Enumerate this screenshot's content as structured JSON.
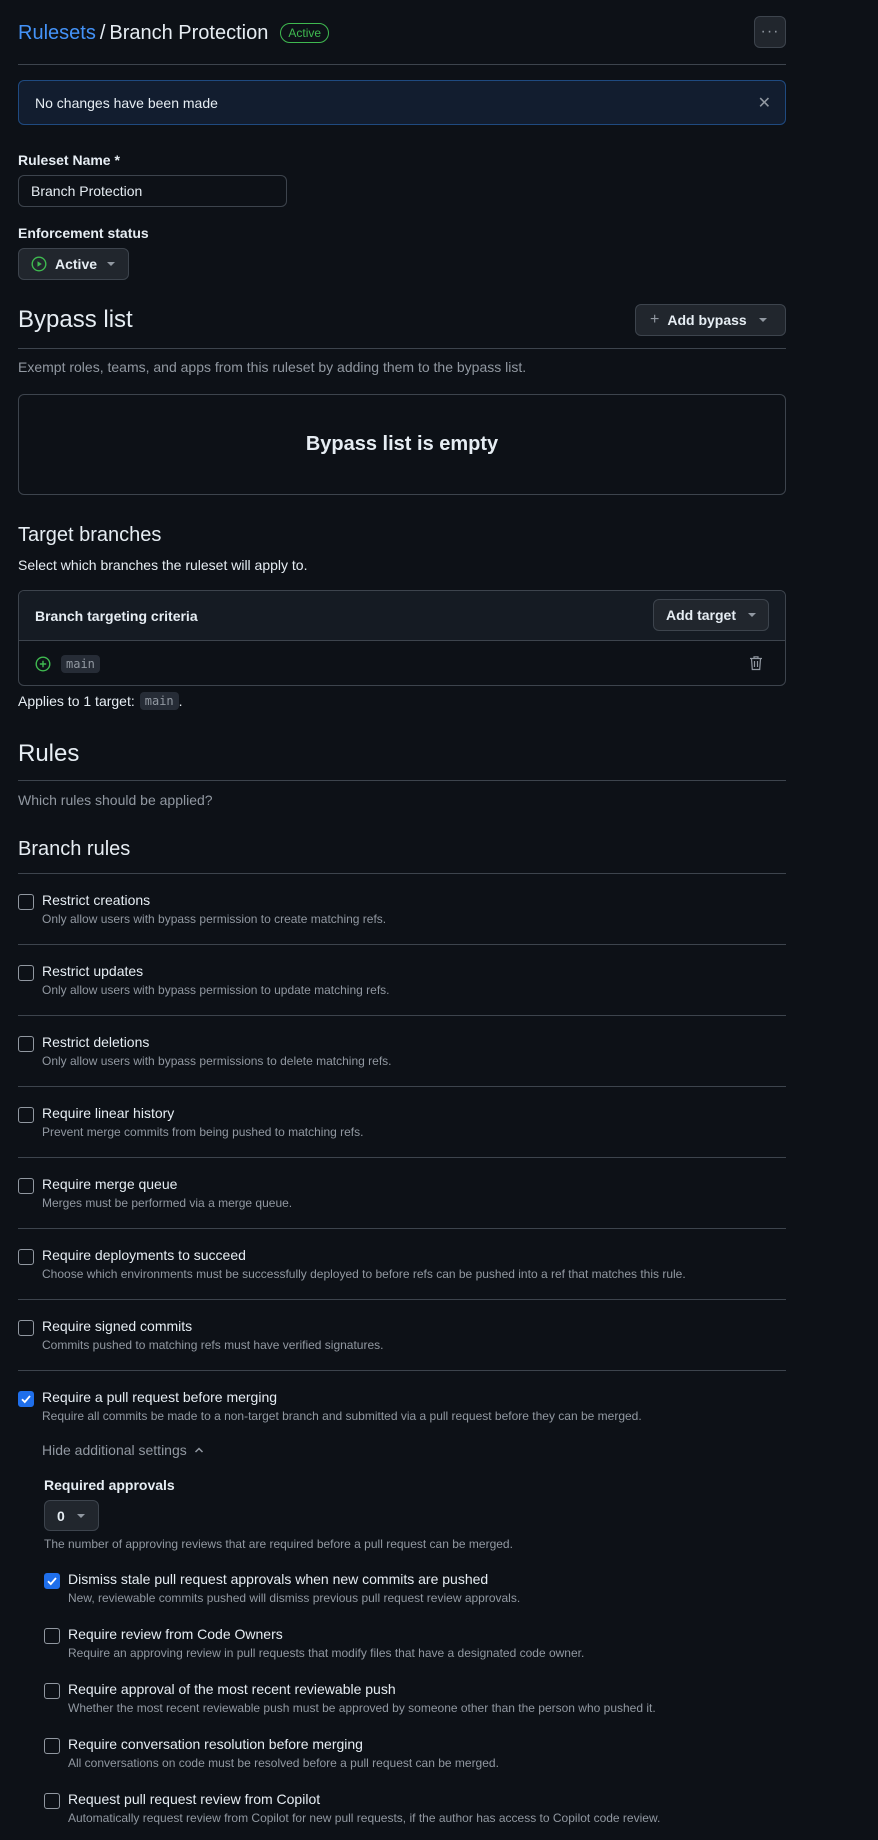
{
  "header": {
    "breadcrumb_link": "Rulesets",
    "breadcrumb_sep": "/",
    "breadcrumb_current": "Branch Protection",
    "status_badge": "Active",
    "more_icon": "kebab-horizontal-icon"
  },
  "flash": {
    "message": "No changes have been made",
    "close_icon": "x-icon"
  },
  "ruleset_name": {
    "label": "Ruleset Name *",
    "value": "Branch Protection"
  },
  "enforcement": {
    "label": "Enforcement status",
    "value": "Active",
    "icon": "play-circle-icon"
  },
  "bypass": {
    "title": "Bypass list",
    "add_button": "Add bypass",
    "description": "Exempt roles, teams, and apps from this ruleset by adding them to the bypass list.",
    "empty_text": "Bypass list is empty"
  },
  "targets": {
    "title": "Target branches",
    "description": "Select which branches the ruleset will apply to.",
    "criteria_header": "Branch targeting criteria",
    "add_button": "Add target",
    "rows": [
      {
        "branch": "main"
      }
    ],
    "applies_prefix": "Applies to 1 target:",
    "applies_branch": "main",
    "applies_suffix": "."
  },
  "rules": {
    "title": "Rules",
    "description": "Which rules should be applied?",
    "branch_rules_title": "Branch rules",
    "items": [
      {
        "title": "Restrict creations",
        "desc": "Only allow users with bypass permission to create matching refs.",
        "checked": false
      },
      {
        "title": "Restrict updates",
        "desc": "Only allow users with bypass permission to update matching refs.",
        "checked": false
      },
      {
        "title": "Restrict deletions",
        "desc": "Only allow users with bypass permissions to delete matching refs.",
        "checked": false
      },
      {
        "title": "Require linear history",
        "desc": "Prevent merge commits from being pushed to matching refs.",
        "checked": false
      },
      {
        "title": "Require merge queue",
        "desc": "Merges must be performed via a merge queue.",
        "checked": false
      },
      {
        "title": "Require deployments to succeed",
        "desc": "Choose which environments must be successfully deployed to before refs can be pushed into a ref that matches this rule.",
        "checked": false
      },
      {
        "title": "Require signed commits",
        "desc": "Commits pushed to matching refs must have verified signatures.",
        "checked": false
      },
      {
        "title": "Require a pull request before merging",
        "desc": "Require all commits be made to a non-target branch and submitted via a pull request before they can be merged.",
        "checked": true
      }
    ],
    "pr_settings": {
      "toggle_label": "Hide additional settings",
      "approvals_label": "Required approvals",
      "approvals_value": "0",
      "approvals_desc": "The number of approving reviews that are required before a pull request can be merged.",
      "options": [
        {
          "title": "Dismiss stale pull request approvals when new commits are pushed",
          "desc": "New, reviewable commits pushed will dismiss previous pull request review approvals.",
          "checked": true
        },
        {
          "title": "Require review from Code Owners",
          "desc": "Require an approving review in pull requests that modify files that have a designated code owner.",
          "checked": false
        },
        {
          "title": "Require approval of the most recent reviewable push",
          "desc": "Whether the most recent reviewable push must be approved by someone other than the person who pushed it.",
          "checked": false
        },
        {
          "title": "Require conversation resolution before merging",
          "desc": "All conversations on code must be resolved before a pull request can be merged.",
          "checked": false
        },
        {
          "title": "Request pull request review from Copilot",
          "desc": "Automatically request review from Copilot for new pull requests, if the author has access to Copilot code review.",
          "checked": false
        }
      ]
    }
  },
  "colors": {
    "accent": "#4493f8",
    "success": "#3fb950",
    "checkbox_checked": "#1f6feb",
    "background": "#0d1117"
  }
}
